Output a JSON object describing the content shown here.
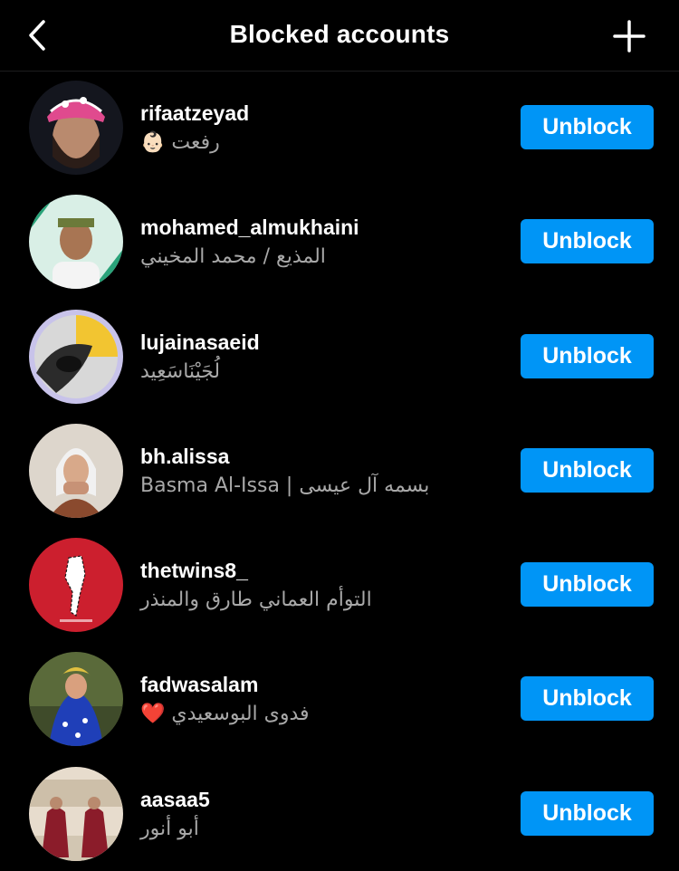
{
  "header": {
    "title": "Blocked accounts",
    "back_icon": "chevron-left-icon",
    "add_icon": "plus-icon"
  },
  "colors": {
    "background": "#000000",
    "accent": "#0095f6",
    "secondary_text": "#a8a8a8"
  },
  "accounts": [
    {
      "username": "rifaatzeyad",
      "full_name": "👶🏻 رفعت",
      "button": "Unblock"
    },
    {
      "username": "mohamed_almukhaini",
      "full_name": "المذيع / محمد المخيني",
      "button": "Unblock"
    },
    {
      "username": "lujainasaeid",
      "full_name": "لُجَيْنَاسَعِيد",
      "button": "Unblock"
    },
    {
      "username": "bh.alissa",
      "full_name": "Basma Al-Issa | بسمه آل عيسى",
      "button": "Unblock"
    },
    {
      "username": "thetwins8_",
      "full_name": "التوأم العماني طارق والمنذر",
      "button": "Unblock"
    },
    {
      "username": "fadwasalam",
      "full_name": "❤️ فدوى البوسعيدي",
      "button": "Unblock"
    },
    {
      "username": "aasaa5",
      "full_name": "أبو أنور",
      "button": "Unblock"
    }
  ]
}
